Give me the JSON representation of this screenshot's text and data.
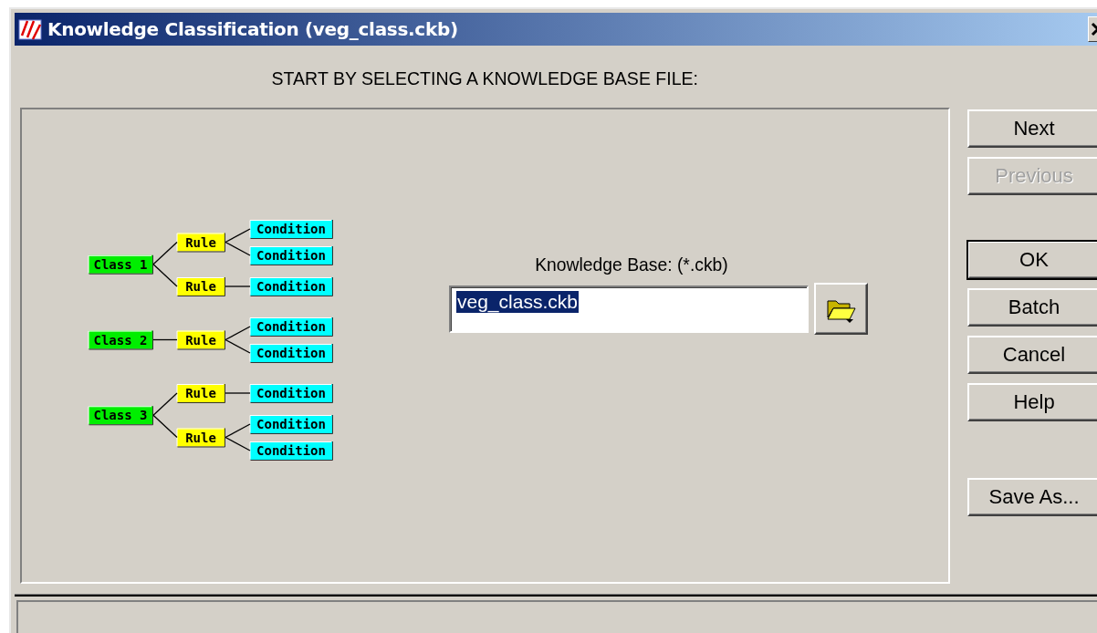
{
  "window": {
    "title": "Knowledge Classification (veg_class.ckb)"
  },
  "heading": "START BY SELECTING A KNOWLEDGE BASE FILE:",
  "diagram": {
    "classes": [
      {
        "label": "Class 1",
        "children": [
          {
            "label": "Rule",
            "children": [
              "Condition",
              "Condition"
            ]
          },
          {
            "label": "Rule",
            "children": [
              "Condition"
            ]
          }
        ]
      },
      {
        "label": "Class 2",
        "children": [
          {
            "label": "Rule",
            "children": [
              "Condition",
              "Condition"
            ]
          }
        ]
      },
      {
        "label": "Class 3",
        "children": [
          {
            "label": "Rule",
            "children": [
              "Condition"
            ]
          },
          {
            "label": "Rule",
            "children": [
              "Condition",
              "Condition"
            ]
          }
        ]
      }
    ]
  },
  "file_field": {
    "label": "Knowledge Base: (*.ckb)",
    "value": "veg_class.ckb",
    "selected": true
  },
  "button_groups": [
    {
      "buttons": [
        {
          "label": "Next",
          "disabled": false,
          "default": false
        },
        {
          "label": "Previous",
          "disabled": true,
          "default": false
        }
      ]
    },
    {
      "buttons": [
        {
          "label": "OK",
          "disabled": false,
          "default": true
        },
        {
          "label": "Batch",
          "disabled": false,
          "default": false
        },
        {
          "label": "Cancel",
          "disabled": false,
          "default": false
        },
        {
          "label": "Help",
          "disabled": false,
          "default": false
        }
      ]
    },
    {
      "buttons": [
        {
          "label": "Save As...",
          "disabled": false,
          "default": false
        }
      ]
    }
  ]
}
